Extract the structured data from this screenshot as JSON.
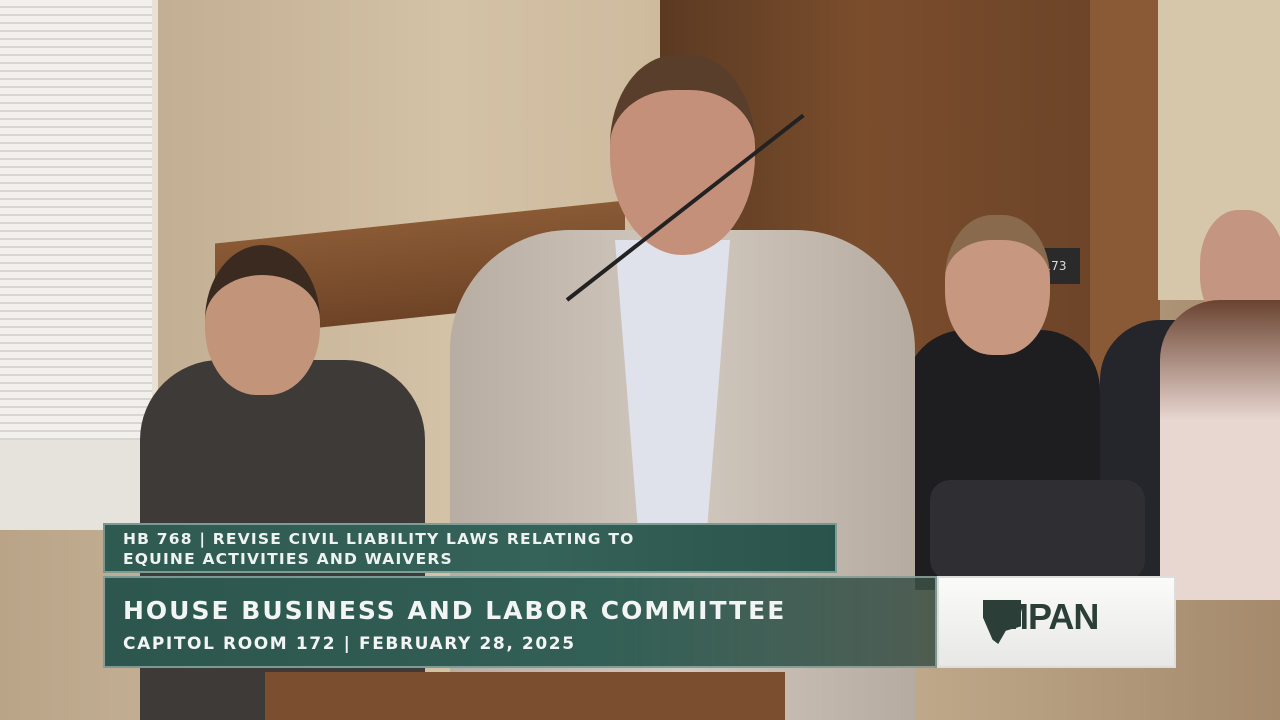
{
  "lower_third": {
    "bill_line1": "HB 768 | REVISE CIVIL LIABILITY LAWS RELATING TO",
    "bill_line2": "EQUINE ACTIVITIES AND WAIVERS",
    "committee": "HOUSE BUSINESS AND LABOR COMMITTEE",
    "location_date": "CAPITOL ROOM 172 | FEBRUARY 28, 2025"
  },
  "logo": {
    "text": "MPAN"
  },
  "scene": {
    "door_number": "173"
  },
  "colors": {
    "banner": "#2f5a52",
    "logo_text": "#2b3e38"
  }
}
